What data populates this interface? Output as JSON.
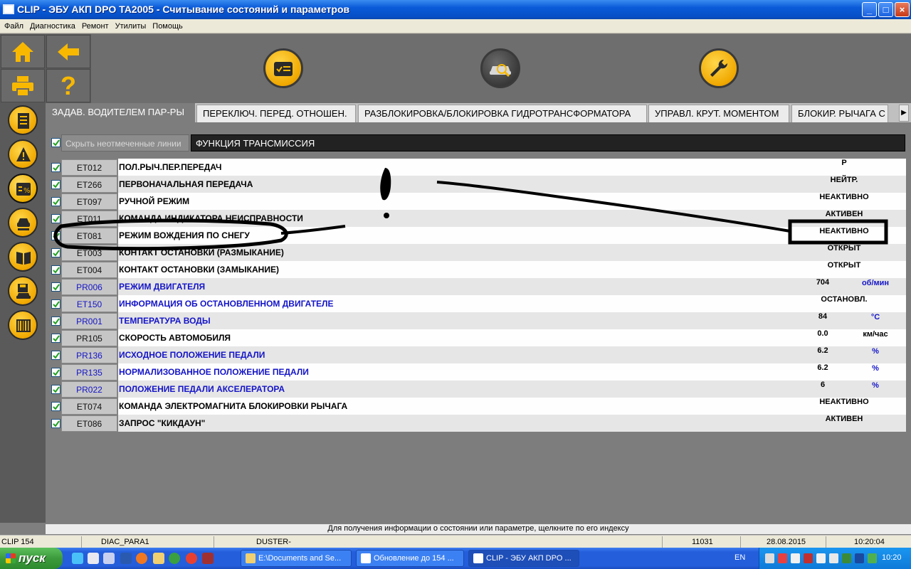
{
  "window": {
    "title": "CLIP - ЭБУ АКП DPO TA2005 - Считывание состояний и параметров",
    "min_label": "_",
    "max_label": "□",
    "close_label": "×"
  },
  "menu": [
    "Файл",
    "Диагностика",
    "Ремонт",
    "Утилиты",
    "Помощь"
  ],
  "nav": {
    "help_label": "?"
  },
  "tabs": [
    {
      "label": "ЗАДАВ. ВОДИТЕЛЕМ ПАР-РЫ",
      "active": true
    },
    {
      "label": "ПЕРЕКЛЮЧ. ПЕРЕД. ОТНОШЕН.",
      "active": false
    },
    {
      "label": "РАЗБЛОКИРОВКА/БЛОКИРОВКА ГИДРОТРАНСФОРМАТОРА",
      "active": false
    },
    {
      "label": "УПРАВЛ. КРУТ. МОМЕНТОМ",
      "active": false
    },
    {
      "label": "БЛОКИР. РЫЧАГА С",
      "active": false
    }
  ],
  "tab_scroll_label": "▶",
  "filter": {
    "hide_label": "Скрыть неотмеченные линии",
    "function_label": "ФУНКЦИЯ ТРАНСМИССИЯ"
  },
  "rows": [
    {
      "code": "ET012",
      "label": "ПОЛ.РЫЧ.ПЕР.ПЕРЕДАЧ",
      "value": "P",
      "unit": "",
      "kind": "state"
    },
    {
      "code": "ET266",
      "label": "ПЕРВОНАЧАЛЬНАЯ ПЕРЕДАЧА",
      "value": "НЕЙТР.",
      "unit": "",
      "kind": "state"
    },
    {
      "code": "ET097",
      "label": "РУЧНОЙ РЕЖИМ",
      "value": "НЕАКТИВНО",
      "unit": "",
      "kind": "state"
    },
    {
      "code": "ET011",
      "label": "КОМАНДА ИНДИКАТОРА НЕИСПРАВНОСТИ",
      "value": "АКТИВЕН",
      "unit": "",
      "kind": "state"
    },
    {
      "code": "ET081",
      "label": "РЕЖИМ ВОЖДЕНИЯ ПО СНЕГУ",
      "value": "НЕАКТИВНО",
      "unit": "",
      "kind": "state"
    },
    {
      "code": "ET003",
      "label": "КОНТАКТ ОСТАНОВКИ (РАЗМЫКАНИЕ)",
      "value": "ОТКРЫТ",
      "unit": "",
      "kind": "state"
    },
    {
      "code": "ET004",
      "label": "КОНТАКТ ОСТАНОВКИ (ЗАМЫКАНИЕ)",
      "value": "ОТКРЫТ",
      "unit": "",
      "kind": "state"
    },
    {
      "code": "PR006",
      "label": "РЕЖИМ ДВИГАТЕЛЯ",
      "value": "704",
      "unit": "об/мин",
      "kind": "param",
      "blue": true
    },
    {
      "code": "ET150",
      "label": "ИНФОРМАЦИЯ ОБ ОСТАНОВЛЕННОМ ДВИГАТЕЛЕ",
      "value": "ОСТАНОВЛ.",
      "unit": "",
      "kind": "state",
      "blue": true
    },
    {
      "code": "PR001",
      "label": "ТЕМПЕРАТУРА ВОДЫ",
      "value": "84",
      "unit": "°C",
      "kind": "param",
      "blue": true
    },
    {
      "code": "PR105",
      "label": "СКОРОСТЬ АВТОМОБИЛЯ",
      "value": "0.0",
      "unit": "км/час",
      "kind": "param",
      "unit_black": true
    },
    {
      "code": "PR136",
      "label": "ИСХОДНОЕ ПОЛОЖЕНИЕ ПЕДАЛИ",
      "value": "6.2",
      "unit": "%",
      "kind": "param",
      "blue": true
    },
    {
      "code": "PR135",
      "label": "НОРМАЛИЗОВАННОЕ ПОЛОЖЕНИЕ ПЕДАЛИ",
      "value": "6.2",
      "unit": "%",
      "kind": "param",
      "blue": true
    },
    {
      "code": "PR022",
      "label": "ПОЛОЖЕНИЕ ПЕДАЛИ АКСЕЛЕРАТОРА",
      "value": "6",
      "unit": "%",
      "kind": "param",
      "blue": true
    },
    {
      "code": "ET074",
      "label": "КОМАНДА ЭЛЕКТРОМАГНИТА БЛОКИРОВКИ РЫЧАГА",
      "value": "НЕАКТИВНО",
      "unit": "",
      "kind": "state"
    },
    {
      "code": "ET086",
      "label": "ЗАПРОС \"КИКДАУН\"",
      "value": "АКТИВЕН",
      "unit": "",
      "kind": "state"
    }
  ],
  "hint": "Для получения информации о состоянии или параметре, щелкните по его индексу",
  "status": {
    "clip": "CLIP 154",
    "diag": "DIAC_PARA1",
    "vehicle": "DUSTER-",
    "code": "11031",
    "date": "28.08.2015",
    "time": "10:20:04"
  },
  "taskbar": {
    "start_label": "пуск",
    "items": [
      {
        "label": "E:\\Documents and Se...",
        "active": false
      },
      {
        "label": "Обновление до 154 ...",
        "active": false
      },
      {
        "label": "CLIP - ЭБУ АКП DPO ...",
        "active": true
      }
    ],
    "lang": "EN",
    "clock": "10:20"
  },
  "colors": {
    "accent": "#f0a800",
    "panel": "#5a5a5a",
    "blue_text": "#1414c8",
    "titlebar": "#0a5ad8"
  }
}
